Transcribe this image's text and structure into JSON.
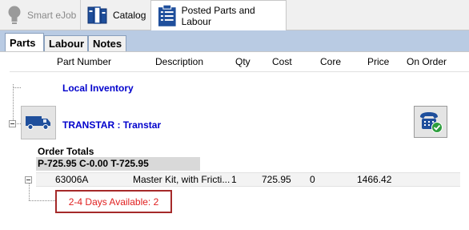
{
  "toolbar": {
    "smart_ejob": "Smart eJob",
    "catalog": "Catalog",
    "posted": "Posted Parts and Labour"
  },
  "subtabs": {
    "parts": "Parts",
    "labour": "Labour",
    "notes": "Notes"
  },
  "columns": {
    "part_number": "Part Number",
    "description": "Description",
    "qty": "Qty",
    "cost": "Cost",
    "core": "Core",
    "price": "Price",
    "on_order": "On Order"
  },
  "tree": {
    "local_inventory": "Local Inventory",
    "supplier": "TRANSTAR : Transtar",
    "order_totals_label": "Order Totals",
    "order_totals_value": "P-725.95 C-0.00 T-725.95"
  },
  "part": {
    "number": "63006A",
    "description": "Master Kit, with Fricti...",
    "qty": "1",
    "cost": "725.95",
    "core": "0",
    "price": "1466.42"
  },
  "availability": "2-4 Days Available: 2"
}
